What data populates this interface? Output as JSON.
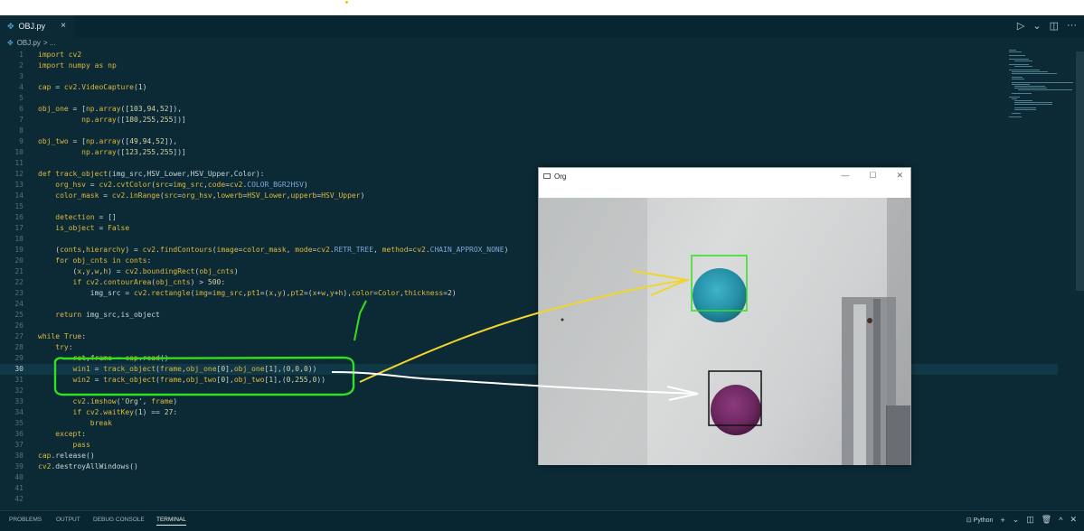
{
  "editor": {
    "tab": {
      "icon": "python-file-icon",
      "label": "OBJ.py",
      "close": "×"
    },
    "breadcrumb": {
      "file": "OBJ.py",
      "rest": "> ..."
    },
    "actions": {
      "run": "▷",
      "run_menu": "⌄",
      "split": "◫",
      "more": "···"
    }
  },
  "code": [
    {
      "n": "1",
      "html": "<span class=\"k\">import</span> <span class=\"n\">cv2</span>"
    },
    {
      "n": "2",
      "html": "<span class=\"k\">import</span> <span class=\"n\">numpy</span> <span class=\"k\">as</span> <span class=\"n\">np</span>"
    },
    {
      "n": "3",
      "html": ""
    },
    {
      "n": "4",
      "html": "<span class=\"n\">cap</span> = <span class=\"n\">cv2</span>.<span class=\"n\">VideoCapture</span>(<span class=\"num\">1</span>)"
    },
    {
      "n": "5",
      "html": ""
    },
    {
      "n": "6",
      "html": "<span class=\"n\">obj_one</span> = [<span class=\"n\">np</span>.<span class=\"n\">array</span>([<span class=\"num\">103</span>,<span class=\"num\">94</span>,<span class=\"num\">52</span>]),"
    },
    {
      "n": "7",
      "html": "          <span class=\"n\">np</span>.<span class=\"n\">array</span>([<span class=\"num\">180</span>,<span class=\"num\">255</span>,<span class=\"num\">255</span>])]"
    },
    {
      "n": "8",
      "html": ""
    },
    {
      "n": "9",
      "html": "<span class=\"n\">obj_two</span> = [<span class=\"n\">np</span>.<span class=\"n\">array</span>([<span class=\"num\">49</span>,<span class=\"num\">94</span>,<span class=\"num\">52</span>]),"
    },
    {
      "n": "10",
      "html": "          <span class=\"n\">np</span>.<span class=\"n\">array</span>([<span class=\"num\">123</span>,<span class=\"num\">255</span>,<span class=\"num\">255</span>])]"
    },
    {
      "n": "11",
      "html": ""
    },
    {
      "n": "12",
      "html": "<span class=\"k\">def</span> <span class=\"n\">track_object</span>(img_src,HSV_Lower,HSV_Upper,Color):"
    },
    {
      "n": "13",
      "html": "    <span class=\"n\">org_hsv</span> = <span class=\"n\">cv2</span>.<span class=\"n\">cvtColor</span>(<span class=\"n\">src</span>=<span class=\"n\">img_src</span>,<span class=\"n\">code</span>=<span class=\"n\">cv2</span>.<span class=\"c\">COLOR_BGR2HSV</span>)"
    },
    {
      "n": "14",
      "html": "    <span class=\"n\">color_mask</span> = <span class=\"n\">cv2</span>.<span class=\"n\">inRange</span>(<span class=\"n\">src</span>=<span class=\"n\">org_hsv</span>,<span class=\"n\">lowerb</span>=<span class=\"n\">HSV_Lower</span>,<span class=\"n\">upperb</span>=<span class=\"n\">HSV_Upper</span>)"
    },
    {
      "n": "15",
      "html": ""
    },
    {
      "n": "16",
      "html": "    <span class=\"n\">detection</span> = []"
    },
    {
      "n": "17",
      "html": "    <span class=\"n\">is_object</span> = <span class=\"k\">False</span>"
    },
    {
      "n": "18",
      "html": ""
    },
    {
      "n": "19",
      "html": "    (<span class=\"n\">conts</span>,<span class=\"n\">hierarchy</span>) = <span class=\"n\">cv2</span>.<span class=\"n\">findContours</span>(<span class=\"n\">image</span>=<span class=\"n\">color_mask</span>, <span class=\"n\">mode</span>=<span class=\"n\">cv2</span>.<span class=\"c\">RETR_TREE</span>, <span class=\"n\">method</span>=<span class=\"n\">cv2</span>.<span class=\"c\">CHAIN_APPROX_NONE</span>)"
    },
    {
      "n": "20",
      "html": "    <span class=\"k\">for</span> <span class=\"n\">obj_cnts</span> <span class=\"k\">in</span> <span class=\"n\">conts</span>:"
    },
    {
      "n": "21",
      "html": "        (<span class=\"n\">x</span>,<span class=\"n\">y</span>,<span class=\"n\">w</span>,<span class=\"n\">h</span>) = <span class=\"n\">cv2</span>.<span class=\"n\">boundingRect</span>(<span class=\"n\">obj_cnts</span>)"
    },
    {
      "n": "22",
      "html": "        <span class=\"k\">if</span> <span class=\"n\">cv2</span>.<span class=\"n\">contourArea</span>(<span class=\"n\">obj_cnts</span>) &gt; <span class=\"num\">500</span>:"
    },
    {
      "n": "23",
      "html": "            <span>img_src</span> = <span class=\"n\">cv2</span>.<span class=\"n\">rectangle</span>(<span class=\"n\">img</span>=<span class=\"n\">img_src</span>,<span class=\"n\">pt1</span>=(<span class=\"n\">x</span>,<span class=\"n\">y</span>),<span class=\"n\">pt2</span>=(<span class=\"n\">x</span>+<span class=\"n\">w</span>,<span class=\"n\">y</span>+<span class=\"n\">h</span>),<span class=\"n\">color</span>=<span class=\"n\">Color</span>,<span class=\"n\">thickness</span>=<span class=\"num\">2</span>)"
    },
    {
      "n": "24",
      "html": ""
    },
    {
      "n": "25",
      "html": "    <span class=\"k\">return</span> img_src,is_object"
    },
    {
      "n": "26",
      "html": ""
    },
    {
      "n": "27",
      "html": "<span class=\"k\">while</span> <span class=\"k\">True</span>:"
    },
    {
      "n": "28",
      "html": "    <span class=\"k\">try</span>:"
    },
    {
      "n": "29",
      "html": "        <span class=\"n\">ret</span>,<span class=\"n\">frame</span> = <span class=\"n\">cap</span>.<span class=\"n\">read</span>()"
    },
    {
      "n": "30",
      "html": "        <span class=\"n\">win1</span> = <span class=\"n\">track_object</span>(<span class=\"n\">frame</span>,<span class=\"n\">obj_one</span>[<span class=\"num\">0</span>],<span class=\"n\">obj_one</span>[<span class=\"num\">1</span>],(<span class=\"num\">0</span>,<span class=\"num\">0</span>,<span class=\"num\">0</span>))"
    },
    {
      "n": "31",
      "html": "        <span class=\"n\">win2</span> = <span class=\"n\">track_object</span>(<span class=\"n\">frame</span>,<span class=\"n\">obj_two</span>[<span class=\"num\">0</span>],<span class=\"n\">obj_two</span>[<span class=\"num\">1</span>],(<span class=\"num\">0</span>,<span class=\"num\">255</span>,<span class=\"num\">0</span>))"
    },
    {
      "n": "32",
      "html": ""
    },
    {
      "n": "33",
      "html": "        <span class=\"n\">cv2</span>.<span class=\"n\">imshow</span>(<span class=\"num\">'Org'</span>, <span class=\"n\">frame</span>)"
    },
    {
      "n": "34",
      "html": "        <span class=\"k\">if</span> <span class=\"n\">cv2</span>.<span class=\"n\">waitKey</span>(<span class=\"num\">1</span>) == <span class=\"num\">27</span>:"
    },
    {
      "n": "35",
      "html": "            <span class=\"k\">break</span>"
    },
    {
      "n": "36",
      "html": "    <span class=\"k\">except</span>:"
    },
    {
      "n": "37",
      "html": "        <span class=\"k\">pass</span>"
    },
    {
      "n": "38",
      "html": "<span class=\"n\">cap</span>.<span>release</span>()"
    },
    {
      "n": "39",
      "html": "<span class=\"n\">cv2</span>.<span>destroyAllWindows</span>()"
    },
    {
      "n": "40",
      "html": ""
    },
    {
      "n": "41",
      "html": ""
    },
    {
      "n": "42",
      "html": ""
    }
  ],
  "active_line": "30",
  "panel": {
    "tabs": [
      "PROBLEMS",
      "OUTPUT",
      "DEBUG CONSOLE",
      "TERMINAL"
    ],
    "active_tab": "TERMINAL",
    "terminal_label": "Python",
    "right_icons": [
      "terminal-icon",
      "plus-icon",
      "chevron-down-icon",
      "split-icon",
      "trash-icon",
      "chevron-up-icon",
      "close-icon"
    ]
  },
  "window": {
    "title": "Org",
    "controls": [
      "—",
      "☐",
      "✕"
    ]
  },
  "annotations": {
    "colors": {
      "green": "#33e01f",
      "yellow": "#f2d52a",
      "white": "#ffffff"
    }
  }
}
